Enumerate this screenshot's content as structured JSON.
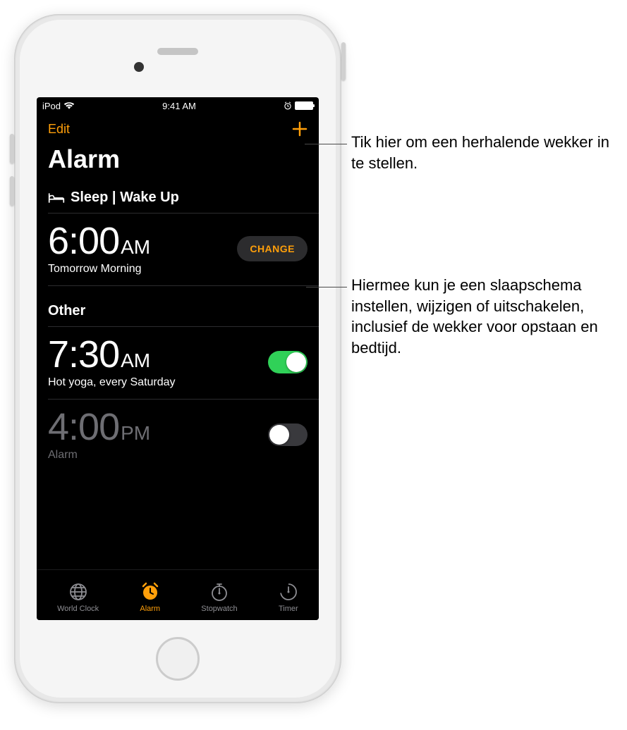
{
  "status": {
    "carrier": "iPod",
    "time": "9:41 AM"
  },
  "nav": {
    "edit": "Edit",
    "title": "Alarm"
  },
  "sleep": {
    "header": "Sleep | Wake Up",
    "time": "6:00",
    "ampm": "AM",
    "sub": "Tomorrow Morning",
    "change": "CHANGE"
  },
  "other": {
    "header": "Other"
  },
  "alarms": [
    {
      "time": "7:30",
      "ampm": "AM",
      "sub": "Hot yoga, every Saturday",
      "on": true
    },
    {
      "time": "4:00",
      "ampm": "PM",
      "sub": "Alarm",
      "on": false
    }
  ],
  "tabs": {
    "world": "World Clock",
    "alarm": "Alarm",
    "stopwatch": "Stopwatch",
    "timer": "Timer"
  },
  "callouts": {
    "add": "Tik hier om een herhalende wekker in te stellen.",
    "change": "Hiermee kun je een slaapschema instellen, wijzigen of uitschakelen, inclusief de wekker voor opstaan en bedtijd."
  }
}
